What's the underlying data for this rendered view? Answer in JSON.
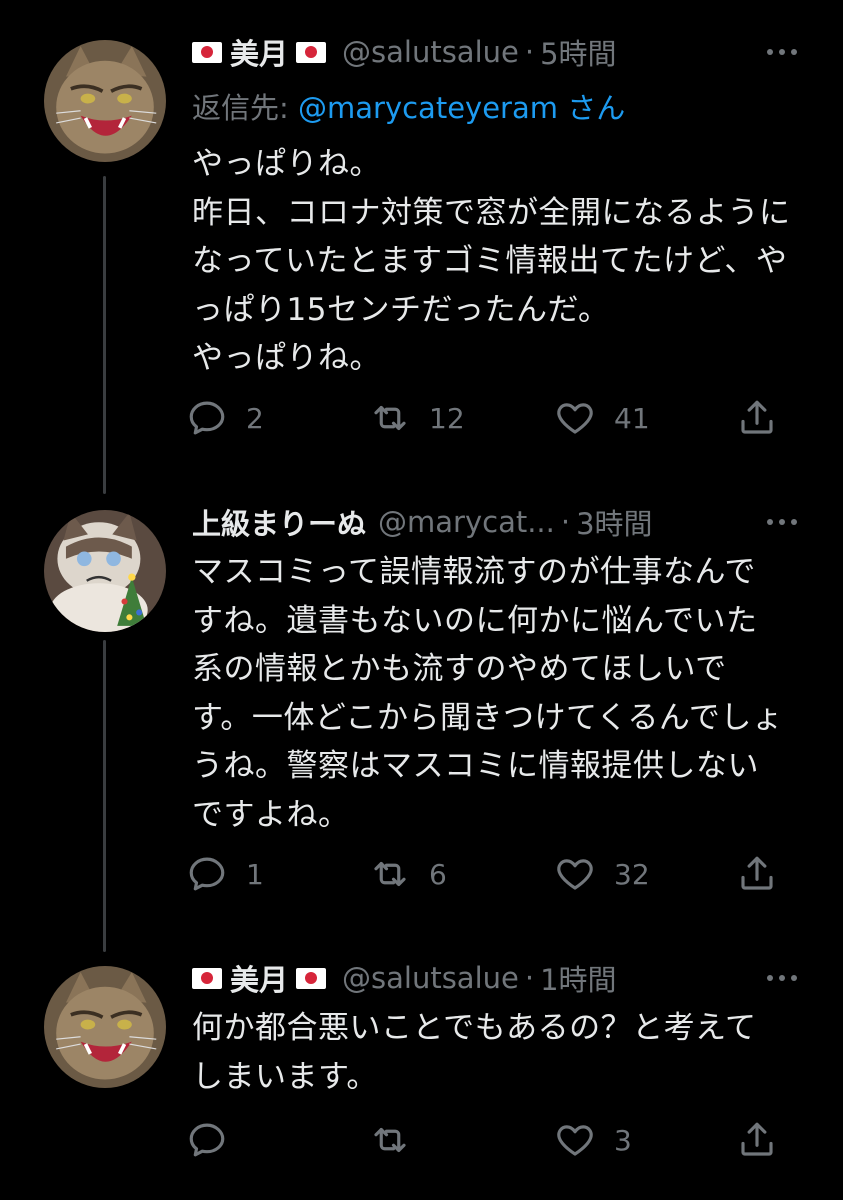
{
  "tweets": [
    {
      "name": "美月",
      "handle": "@salutsalue",
      "separator": "·",
      "time": "5時間",
      "reply_prefix": "返信先: ",
      "reply_mention": "@marycateyeram",
      "reply_suffix": " さん",
      "text": "やっぱりね。\n昨日、コロナ対策で窓が全開になるようになっていたとますゴミ情報出てたけど、やっぱり15センチだったんだ。\nやっぱりね。",
      "replies": "2",
      "retweets": "12",
      "likes": "41"
    },
    {
      "name": "上級まりーぬ",
      "handle": "@marycat...",
      "separator": "·",
      "time": "3時間",
      "text": "マスコミって誤情報流すのが仕事なんですね。遺書もないのに何かに悩んでいた系の情報とかも流すのやめてほしいです。一体どこから聞きつけてくるんでしょうね。警察はマスコミに情報提供しないですよね。",
      "replies": "1",
      "retweets": "6",
      "likes": "32"
    },
    {
      "name": "美月",
      "handle": "@salutsalue",
      "separator": "·",
      "time": "1時間",
      "text": "何か都合悪いことでもあるの？と考えてしまいます。",
      "replies": "",
      "retweets": "",
      "likes": "3"
    }
  ],
  "icons": [
    "reply-icon",
    "retweet-icon",
    "like-icon",
    "share-icon",
    "more-icon",
    "flag-japan-icon"
  ]
}
